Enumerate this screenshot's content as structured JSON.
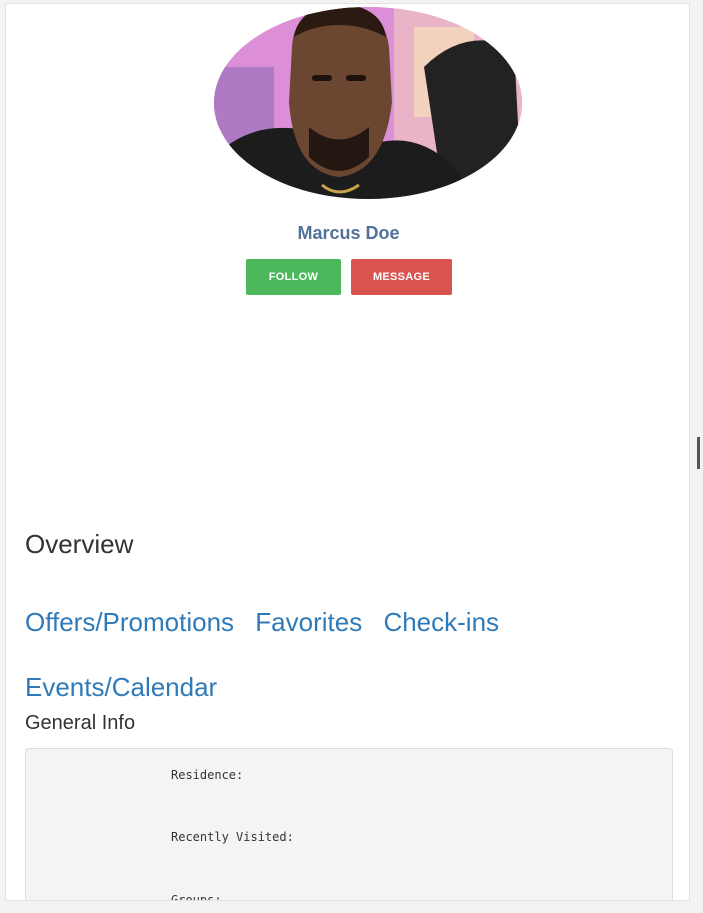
{
  "profile": {
    "name": "Marcus Doe",
    "avatar_alt": "profile-photo"
  },
  "actions": {
    "follow_label": "FOLLOW",
    "message_label": "MESSAGE",
    "follow_color": "#4cb85c",
    "message_color": "#d9534f"
  },
  "overview": {
    "heading": "Overview",
    "tabs": [
      {
        "label": "Offers/Promotions"
      },
      {
        "label": "Favorites"
      },
      {
        "label": "Check-ins"
      },
      {
        "label": "Events/Calendar"
      }
    ]
  },
  "general_info": {
    "heading": "General Info",
    "rows": [
      {
        "label": "Residence:"
      },
      {
        "label": "Recently Visited:"
      },
      {
        "label": "Groups:"
      }
    ]
  },
  "colors": {
    "link": "#2f7ab8",
    "name": "#52729a"
  }
}
